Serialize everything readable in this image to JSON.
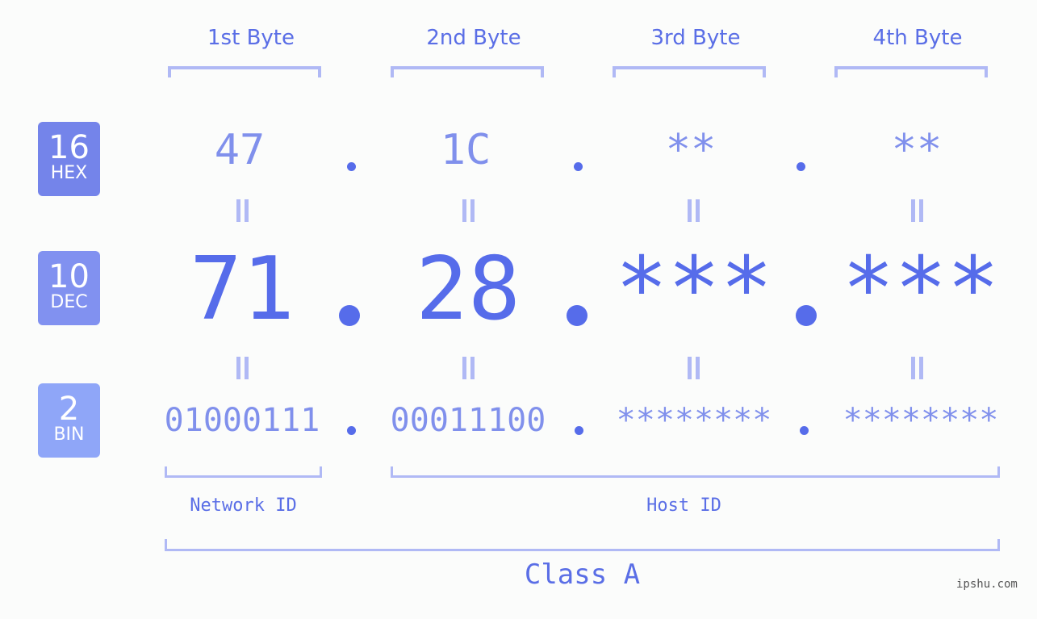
{
  "headers": [
    "1st Byte",
    "2nd Byte",
    "3rd Byte",
    "4th Byte"
  ],
  "bases": [
    {
      "number": "16",
      "label": "HEX",
      "color": "#7484ea"
    },
    {
      "number": "10",
      "label": "DEC",
      "color": "#8191f0"
    },
    {
      "number": "2",
      "label": "BIN",
      "color": "#8fa6f8"
    }
  ],
  "rows": {
    "hex": [
      "47",
      "1C",
      "**",
      "**"
    ],
    "dec": [
      "71",
      "28",
      "***",
      "***"
    ],
    "bin": [
      "01000111",
      "00011100",
      "********",
      "********"
    ]
  },
  "groups": {
    "network_label": "Network ID",
    "host_label": "Host ID",
    "class_label": "Class A"
  },
  "watermark": "ipshu.com",
  "colors": {
    "accent": "#566cea",
    "light": "#8090ec",
    "bracket": "#b0b9f5",
    "background": "#fbfcfb"
  }
}
